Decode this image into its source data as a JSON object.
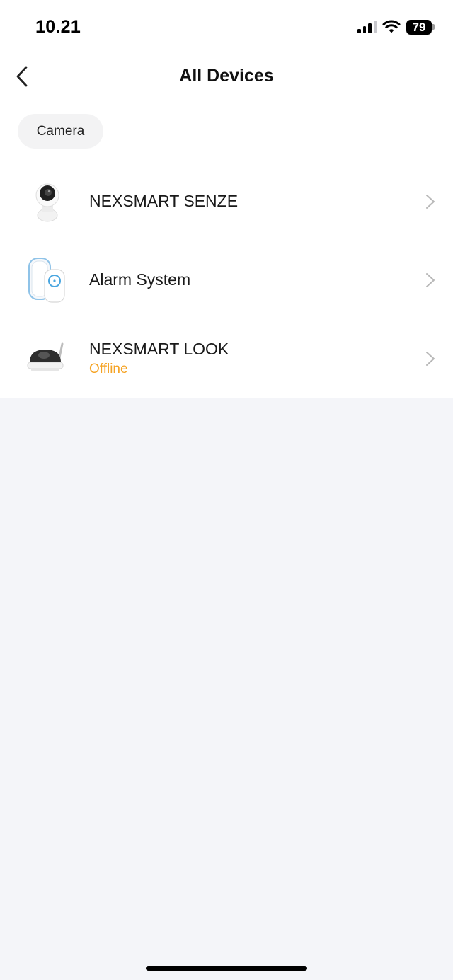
{
  "status_bar": {
    "time": "10.21",
    "battery": "79"
  },
  "nav": {
    "title": "All Devices",
    "back_icon": "chevron-left-icon"
  },
  "filter": {
    "chip_label": "Camera"
  },
  "devices": [
    {
      "name": "NEXSMART SENZE",
      "status": "",
      "image": "indoor-camera"
    },
    {
      "name": "Alarm System",
      "status": "",
      "image": "alarm-hub-and-keypad"
    },
    {
      "name": "NEXSMART LOOK",
      "status": "Offline",
      "image": "dome-camera"
    }
  ],
  "colors": {
    "offline": "#f5a324",
    "background": "#f4f5f9",
    "card": "#ffffff"
  }
}
